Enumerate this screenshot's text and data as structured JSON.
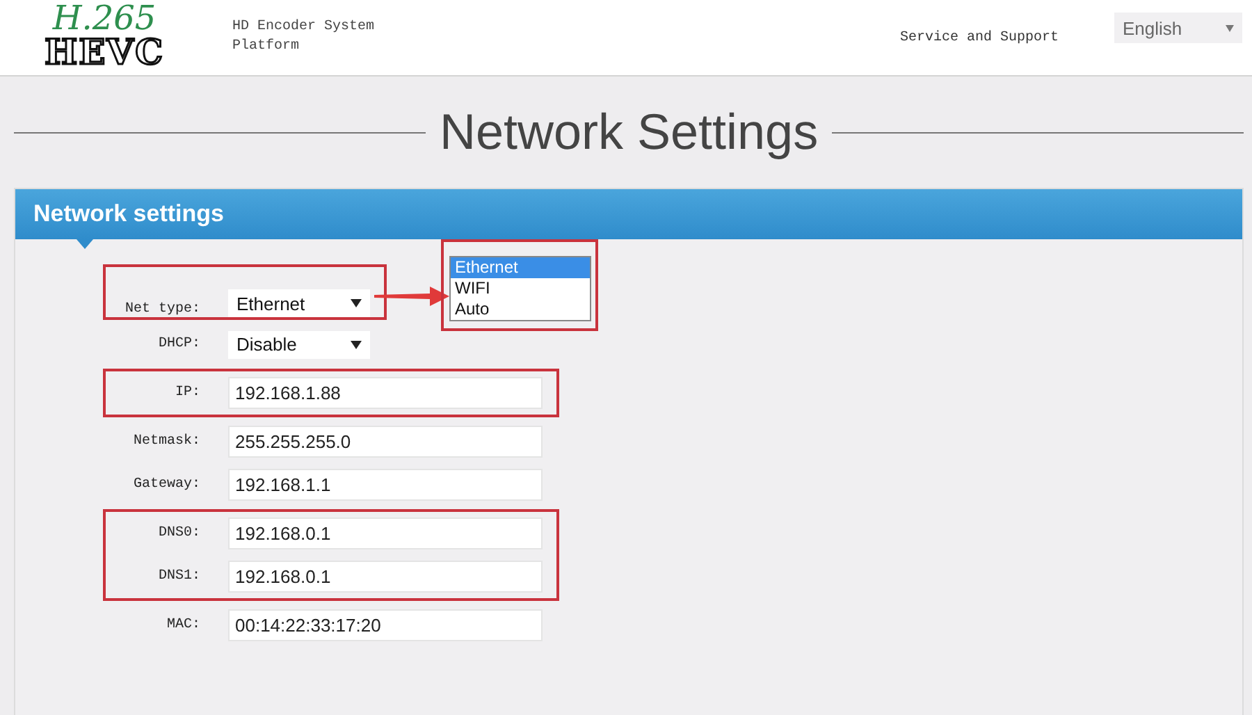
{
  "header": {
    "logo_top": "H.265",
    "logo_bottom": "HEVC",
    "product": "HD Encoder System Platform",
    "support_link": "Service and Support",
    "language": "English"
  },
  "page_title": "Network Settings",
  "panel": {
    "title": "Network settings",
    "groups": [
      {
        "marked": true,
        "rows": [
          {
            "label": "Net type:",
            "kind": "select",
            "value": "Ethernet"
          }
        ]
      },
      {
        "marked": false,
        "rows": [
          {
            "label": "DHCP:",
            "kind": "select",
            "value": "Disable"
          }
        ]
      },
      {
        "marked": true,
        "rows": [
          {
            "label": "IP:",
            "kind": "input",
            "value": "192.168.1.88"
          }
        ]
      },
      {
        "marked": false,
        "rows": [
          {
            "label": "Netmask:",
            "kind": "input",
            "value": "255.255.255.0"
          },
          {
            "label": "Gateway:",
            "kind": "input",
            "value": "192.168.1.1"
          }
        ]
      },
      {
        "marked": true,
        "rows": [
          {
            "label": "DNS0:",
            "kind": "input",
            "value": "192.168.0.1"
          },
          {
            "label": "DNS1:",
            "kind": "input",
            "value": "192.168.0.1"
          }
        ]
      },
      {
        "marked": false,
        "rows": [
          {
            "label": "MAC:",
            "kind": "input",
            "value": "00:14:22:33:17:20"
          }
        ]
      }
    ],
    "dropdown": {
      "marked": true,
      "options": [
        {
          "label": "Ethernet",
          "selected": true
        },
        {
          "label": "WIFI",
          "selected": false
        },
        {
          "label": "Auto",
          "selected": false
        }
      ]
    }
  }
}
